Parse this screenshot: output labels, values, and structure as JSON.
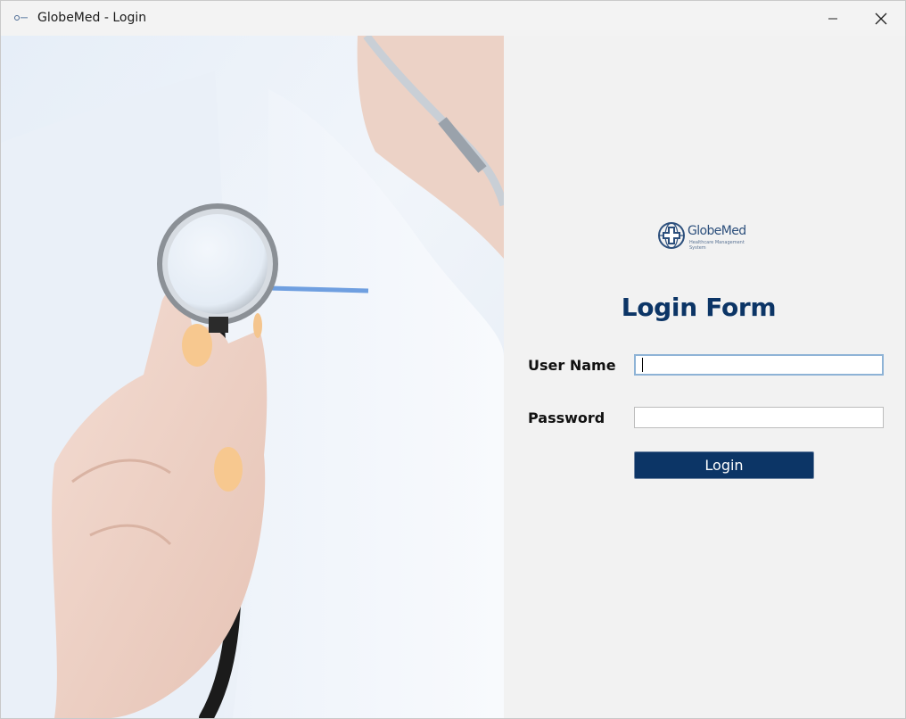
{
  "window": {
    "title": "GlobeMed - Login",
    "icons": {
      "app": "globemed-app-icon",
      "minimize": "minimize-icon",
      "close": "close-icon"
    }
  },
  "photo": {
    "subject": "hand-holding-stethoscope-image"
  },
  "logo": {
    "name": "GlobeMed",
    "tagline": "Healthcare Management System",
    "icon": "globe-cross-icon"
  },
  "form": {
    "title": "Login Form",
    "username_label": "User Name",
    "username_value": "",
    "password_label": "Password",
    "password_value": "",
    "login_label": "Login"
  },
  "colors": {
    "brand_navy": "#0c3566",
    "focus_border": "#8eb3d6",
    "panel_bg": "#f2f2f2"
  }
}
